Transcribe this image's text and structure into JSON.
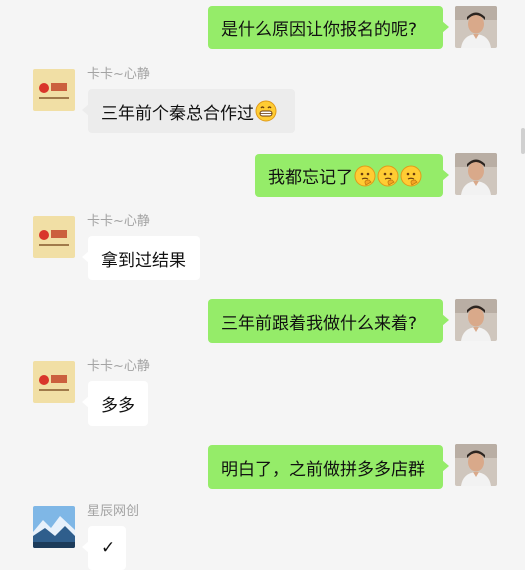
{
  "messages": [
    {
      "direction": "out",
      "text": "是什么原因让你报名的呢?"
    },
    {
      "direction": "in",
      "sender": "卡卡~心静",
      "text": "三年前个秦总合作过"
    },
    {
      "direction": "out",
      "text": "我都忘记了"
    },
    {
      "direction": "in",
      "sender": "卡卡~心静",
      "text": "拿到过结果"
    },
    {
      "direction": "out",
      "text": "三年前跟着我做什么来着?"
    },
    {
      "direction": "in",
      "sender": "卡卡~心静",
      "text": "多多"
    },
    {
      "direction": "out",
      "text": "明白了，之前做拼多多店群"
    },
    {
      "direction": "in",
      "sender": "星辰网创",
      "text": "✓"
    }
  ],
  "icons": {
    "grin": "grinning-face-emoji",
    "think": "thinking-face-emoji"
  },
  "colors": {
    "background": "#f5f5f5",
    "outgoing_bubble": "#95ec69",
    "incoming_bubble": "#ffffff",
    "sender_name": "#a3a3a3"
  }
}
